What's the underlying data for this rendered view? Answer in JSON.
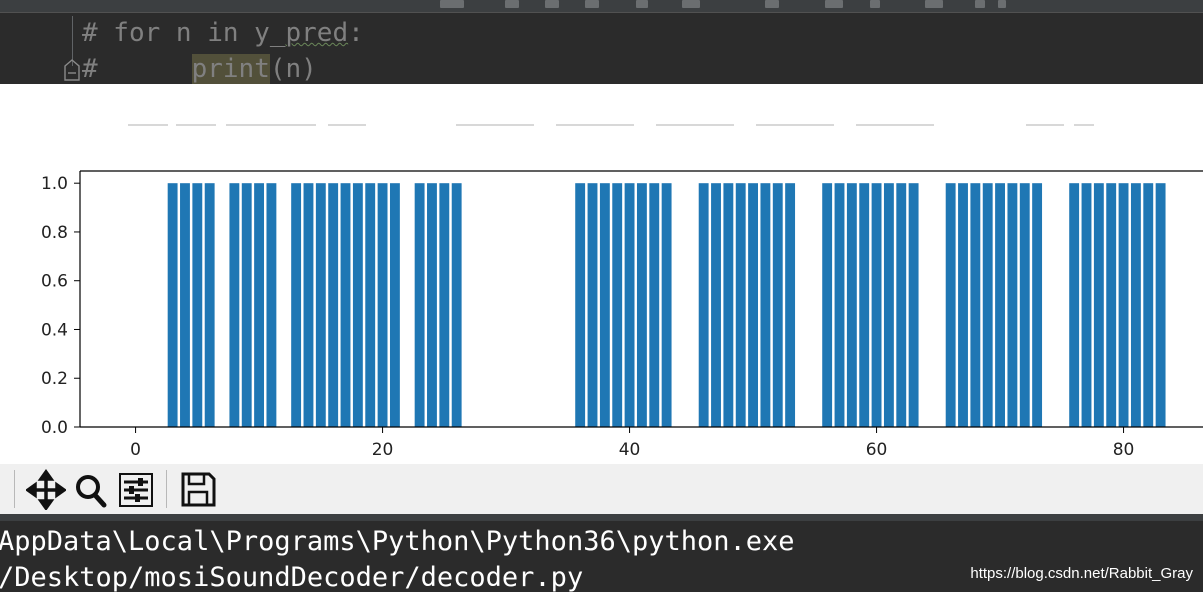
{
  "editor": {
    "code_lines": [
      {
        "prefix": "# for n in y_",
        "squiggle": "pred",
        "suffix": ":"
      },
      {
        "prefix": "#      ",
        "highlight": "print",
        "suffix": "(n)"
      }
    ]
  },
  "chart_data": {
    "type": "bar",
    "x": [
      3,
      4,
      5,
      6,
      8,
      9,
      10,
      11,
      13,
      14,
      15,
      16,
      17,
      18,
      19,
      20,
      21,
      23,
      24,
      25,
      26,
      36,
      37,
      38,
      39,
      40,
      41,
      42,
      43,
      46,
      47,
      48,
      49,
      50,
      51,
      52,
      53,
      56,
      57,
      58,
      59,
      60,
      61,
      62,
      63,
      66,
      67,
      68,
      69,
      70,
      71,
      72,
      73,
      76,
      77,
      78,
      79,
      80,
      81,
      82,
      83
    ],
    "values": [
      1,
      1,
      1,
      1,
      1,
      1,
      1,
      1,
      1,
      1,
      1,
      1,
      1,
      1,
      1,
      1,
      1,
      1,
      1,
      1,
      1,
      1,
      1,
      1,
      1,
      1,
      1,
      1,
      1,
      1,
      1,
      1,
      1,
      1,
      1,
      1,
      1,
      1,
      1,
      1,
      1,
      1,
      1,
      1,
      1,
      1,
      1,
      1,
      1,
      1,
      1,
      1,
      1,
      1,
      1,
      1,
      1,
      1,
      1,
      1,
      1
    ],
    "xticks": [
      "0",
      "20",
      "40",
      "60",
      "80"
    ],
    "yticks": [
      "0.0",
      "0.2",
      "0.4",
      "0.6",
      "0.8",
      "1.0"
    ],
    "xlim": [
      -4.5,
      87
    ],
    "ylim": [
      0,
      1.05
    ],
    "bar_color": "#1f77b4",
    "grid": false,
    "legend": "none"
  },
  "toolbar": {
    "buttons": [
      {
        "name": "pan-tool-button",
        "icon": "move-arrows-icon"
      },
      {
        "name": "zoom-tool-button",
        "icon": "magnifier-icon"
      },
      {
        "name": "subplots-config-button",
        "icon": "sliders-icon"
      },
      {
        "name": "save-figure-button",
        "icon": "floppy-disk-icon"
      }
    ]
  },
  "console": {
    "lines": [
      "AppData\\Local\\Programs\\Python\\Python36\\python.exe",
      "/Desktop/mosiSoundDecoder/decoder.py"
    ]
  },
  "watermark": "https://blog.csdn.net/Rabbit_Gray"
}
